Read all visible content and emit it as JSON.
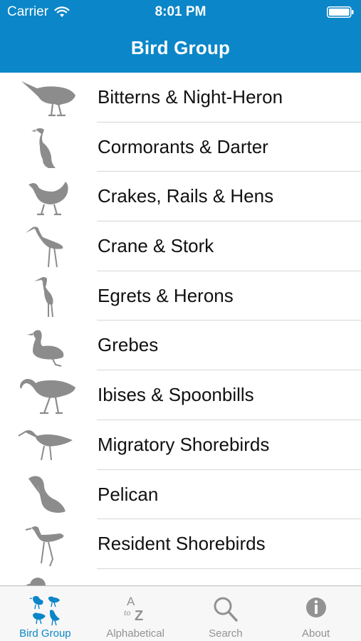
{
  "status_bar": {
    "carrier": "Carrier",
    "time": "8:01 PM"
  },
  "nav": {
    "title": "Bird Group"
  },
  "list": {
    "items": [
      {
        "label": "Bitterns & Night-Heron",
        "icon": "bittern-silhouette-icon"
      },
      {
        "label": "Cormorants & Darter",
        "icon": "cormorant-silhouette-icon"
      },
      {
        "label": "Crakes, Rails & Hens",
        "icon": "rail-silhouette-icon"
      },
      {
        "label": "Crane & Stork",
        "icon": "stork-silhouette-icon"
      },
      {
        "label": "Egrets & Herons",
        "icon": "egret-silhouette-icon"
      },
      {
        "label": "Grebes",
        "icon": "grebe-silhouette-icon"
      },
      {
        "label": "Ibises & Spoonbills",
        "icon": "ibis-silhouette-icon"
      },
      {
        "label": "Migratory Shorebirds",
        "icon": "curlew-silhouette-icon"
      },
      {
        "label": "Pelican",
        "icon": "pelican-silhouette-icon"
      },
      {
        "label": "Resident Shorebirds",
        "icon": "stilt-silhouette-icon"
      },
      {
        "label": "",
        "icon": "duck-silhouette-icon"
      }
    ]
  },
  "tabs": [
    {
      "label": "Bird Group",
      "active": true,
      "icon": "bird-group-icon"
    },
    {
      "label": "Alphabetical",
      "active": false,
      "icon": "a-to-z-icon"
    },
    {
      "label": "Search",
      "active": false,
      "icon": "search-icon"
    },
    {
      "label": "About",
      "active": false,
      "icon": "info-icon"
    }
  ],
  "colors": {
    "accent": "#0b86c8",
    "silhouette": "#8c8c8c",
    "separator": "#d6d6d6",
    "tab_inactive": "#929292"
  }
}
